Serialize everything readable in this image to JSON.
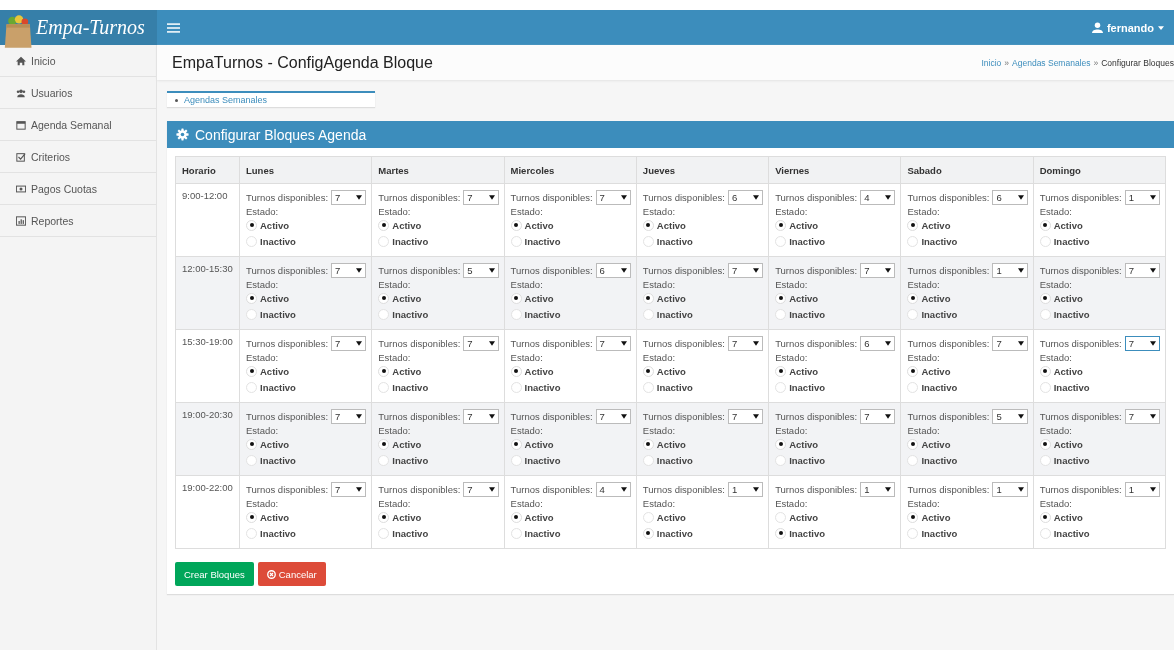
{
  "header": {
    "logo": "Empa-Turnos",
    "user": "fernando"
  },
  "sidebar": {
    "items": [
      {
        "label": "Inicio"
      },
      {
        "label": "Usuarios"
      },
      {
        "label": "Agenda Semanal"
      },
      {
        "label": "Criterios"
      },
      {
        "label": "Pagos Cuotas"
      },
      {
        "label": "Reportes"
      }
    ]
  },
  "page_title": "EmpaTurnos - ConfigAgenda Bloque",
  "breadcrumb": [
    {
      "kind": "link",
      "label": "Inicio"
    },
    {
      "kind": "sep",
      "label": "»"
    },
    {
      "kind": "link",
      "label": "Agendas Semanales"
    },
    {
      "kind": "sep",
      "label": "»"
    },
    {
      "kind": "current",
      "label": "Configurar Bloques"
    }
  ],
  "subnav": {
    "label": "Agendas Semanales"
  },
  "panel": {
    "title": "Configurar Bloques Agenda"
  },
  "table": {
    "columns": [
      "Horario",
      "Lunes",
      "Martes",
      "Miercoles",
      "Jueves",
      "Viernes",
      "Sabado",
      "Domingo"
    ],
    "rows": [
      {
        "cells": [
          {
            "kind": "time",
            "text": "9:00-12:00"
          },
          {
            "turnos_label": "Turnos disponibles:",
            "turnos": "7",
            "focused": false,
            "estado_label": "Estado:",
            "options": [
              {
                "label": "Activo",
                "selected": true
              },
              {
                "label": "Inactivo",
                "selected": false
              }
            ]
          },
          {
            "turnos_label": "Turnos disponibles:",
            "turnos": "7",
            "focused": false,
            "estado_label": "Estado:",
            "options": [
              {
                "label": "Activo",
                "selected": true
              },
              {
                "label": "Inactivo",
                "selected": false
              }
            ]
          },
          {
            "turnos_label": "Turnos disponibles:",
            "turnos": "7",
            "focused": false,
            "estado_label": "Estado:",
            "options": [
              {
                "label": "Activo",
                "selected": true
              },
              {
                "label": "Inactivo",
                "selected": false
              }
            ]
          },
          {
            "turnos_label": "Turnos disponibles:",
            "turnos": "6",
            "focused": false,
            "estado_label": "Estado:",
            "options": [
              {
                "label": "Activo",
                "selected": true
              },
              {
                "label": "Inactivo",
                "selected": false
              }
            ]
          },
          {
            "turnos_label": "Turnos disponibles:",
            "turnos": "4",
            "focused": false,
            "estado_label": "Estado:",
            "options": [
              {
                "label": "Activo",
                "selected": true
              },
              {
                "label": "Inactivo",
                "selected": false
              }
            ]
          },
          {
            "turnos_label": "Turnos disponibles:",
            "turnos": "6",
            "focused": false,
            "estado_label": "Estado:",
            "options": [
              {
                "label": "Activo",
                "selected": true
              },
              {
                "label": "Inactivo",
                "selected": false
              }
            ]
          },
          {
            "turnos_label": "Turnos disponibles:",
            "turnos": "1",
            "focused": false,
            "estado_label": "Estado:",
            "options": [
              {
                "label": "Activo",
                "selected": true
              },
              {
                "label": "Inactivo",
                "selected": false
              }
            ]
          }
        ]
      },
      {
        "cells": [
          {
            "kind": "time",
            "text": "12:00-15:30"
          },
          {
            "turnos_label": "Turnos disponibles:",
            "turnos": "7",
            "focused": false,
            "estado_label": "Estado:",
            "options": [
              {
                "label": "Activo",
                "selected": true
              },
              {
                "label": "Inactivo",
                "selected": false
              }
            ]
          },
          {
            "turnos_label": "Turnos disponibles:",
            "turnos": "5",
            "focused": false,
            "estado_label": "Estado:",
            "options": [
              {
                "label": "Activo",
                "selected": true
              },
              {
                "label": "Inactivo",
                "selected": false
              }
            ]
          },
          {
            "turnos_label": "Turnos disponibles:",
            "turnos": "6",
            "focused": false,
            "estado_label": "Estado:",
            "options": [
              {
                "label": "Activo",
                "selected": true
              },
              {
                "label": "Inactivo",
                "selected": false
              }
            ]
          },
          {
            "turnos_label": "Turnos disponibles:",
            "turnos": "7",
            "focused": false,
            "estado_label": "Estado:",
            "options": [
              {
                "label": "Activo",
                "selected": true
              },
              {
                "label": "Inactivo",
                "selected": false
              }
            ]
          },
          {
            "turnos_label": "Turnos disponibles:",
            "turnos": "7",
            "focused": false,
            "estado_label": "Estado:",
            "options": [
              {
                "label": "Activo",
                "selected": true
              },
              {
                "label": "Inactivo",
                "selected": false
              }
            ]
          },
          {
            "turnos_label": "Turnos disponibles:",
            "turnos": "1",
            "focused": false,
            "estado_label": "Estado:",
            "options": [
              {
                "label": "Activo",
                "selected": true
              },
              {
                "label": "Inactivo",
                "selected": false
              }
            ]
          },
          {
            "turnos_label": "Turnos disponibles:",
            "turnos": "7",
            "focused": false,
            "estado_label": "Estado:",
            "options": [
              {
                "label": "Activo",
                "selected": true
              },
              {
                "label": "Inactivo",
                "selected": false
              }
            ]
          }
        ]
      },
      {
        "cells": [
          {
            "kind": "time",
            "text": "15:30-19:00"
          },
          {
            "turnos_label": "Turnos disponibles:",
            "turnos": "7",
            "focused": false,
            "estado_label": "Estado:",
            "options": [
              {
                "label": "Activo",
                "selected": true
              },
              {
                "label": "Inactivo",
                "selected": false
              }
            ]
          },
          {
            "turnos_label": "Turnos disponibles:",
            "turnos": "7",
            "focused": false,
            "estado_label": "Estado:",
            "options": [
              {
                "label": "Activo",
                "selected": true
              },
              {
                "label": "Inactivo",
                "selected": false
              }
            ]
          },
          {
            "turnos_label": "Turnos disponibles:",
            "turnos": "7",
            "focused": false,
            "estado_label": "Estado:",
            "options": [
              {
                "label": "Activo",
                "selected": true
              },
              {
                "label": "Inactivo",
                "selected": false
              }
            ]
          },
          {
            "turnos_label": "Turnos disponibles:",
            "turnos": "7",
            "focused": false,
            "estado_label": "Estado:",
            "options": [
              {
                "label": "Activo",
                "selected": true
              },
              {
                "label": "Inactivo",
                "selected": false
              }
            ]
          },
          {
            "turnos_label": "Turnos disponibles:",
            "turnos": "6",
            "focused": false,
            "estado_label": "Estado:",
            "options": [
              {
                "label": "Activo",
                "selected": true
              },
              {
                "label": "Inactivo",
                "selected": false
              }
            ]
          },
          {
            "turnos_label": "Turnos disponibles:",
            "turnos": "7",
            "focused": false,
            "estado_label": "Estado:",
            "options": [
              {
                "label": "Activo",
                "selected": true
              },
              {
                "label": "Inactivo",
                "selected": false
              }
            ]
          },
          {
            "turnos_label": "Turnos disponibles:",
            "turnos": "7",
            "focused": true,
            "estado_label": "Estado:",
            "options": [
              {
                "label": "Activo",
                "selected": true
              },
              {
                "label": "Inactivo",
                "selected": false
              }
            ]
          }
        ]
      },
      {
        "cells": [
          {
            "kind": "time",
            "text": "19:00-20:30"
          },
          {
            "turnos_label": "Turnos disponibles:",
            "turnos": "7",
            "focused": false,
            "estado_label": "Estado:",
            "options": [
              {
                "label": "Activo",
                "selected": true
              },
              {
                "label": "Inactivo",
                "selected": false
              }
            ]
          },
          {
            "turnos_label": "Turnos disponibles:",
            "turnos": "7",
            "focused": false,
            "estado_label": "Estado:",
            "options": [
              {
                "label": "Activo",
                "selected": true
              },
              {
                "label": "Inactivo",
                "selected": false
              }
            ]
          },
          {
            "turnos_label": "Turnos disponibles:",
            "turnos": "7",
            "focused": false,
            "estado_label": "Estado:",
            "options": [
              {
                "label": "Activo",
                "selected": true
              },
              {
                "label": "Inactivo",
                "selected": false
              }
            ]
          },
          {
            "turnos_label": "Turnos disponibles:",
            "turnos": "7",
            "focused": false,
            "estado_label": "Estado:",
            "options": [
              {
                "label": "Activo",
                "selected": true
              },
              {
                "label": "Inactivo",
                "selected": false
              }
            ]
          },
          {
            "turnos_label": "Turnos disponibles:",
            "turnos": "7",
            "focused": false,
            "estado_label": "Estado:",
            "options": [
              {
                "label": "Activo",
                "selected": true
              },
              {
                "label": "Inactivo",
                "selected": false
              }
            ]
          },
          {
            "turnos_label": "Turnos disponibles:",
            "turnos": "5",
            "focused": false,
            "estado_label": "Estado:",
            "options": [
              {
                "label": "Activo",
                "selected": true
              },
              {
                "label": "Inactivo",
                "selected": false
              }
            ]
          },
          {
            "turnos_label": "Turnos disponibles:",
            "turnos": "7",
            "focused": false,
            "estado_label": "Estado:",
            "options": [
              {
                "label": "Activo",
                "selected": true
              },
              {
                "label": "Inactivo",
                "selected": false
              }
            ]
          }
        ]
      },
      {
        "cells": [
          {
            "kind": "time",
            "text": "19:00-22:00"
          },
          {
            "turnos_label": "Turnos disponibles:",
            "turnos": "7",
            "focused": false,
            "estado_label": "Estado:",
            "options": [
              {
                "label": "Activo",
                "selected": true
              },
              {
                "label": "Inactivo",
                "selected": false
              }
            ]
          },
          {
            "turnos_label": "Turnos disponibles:",
            "turnos": "7",
            "focused": false,
            "estado_label": "Estado:",
            "options": [
              {
                "label": "Activo",
                "selected": true
              },
              {
                "label": "Inactivo",
                "selected": false
              }
            ]
          },
          {
            "turnos_label": "Turnos disponibles:",
            "turnos": "4",
            "focused": false,
            "estado_label": "Estado:",
            "options": [
              {
                "label": "Activo",
                "selected": true
              },
              {
                "label": "Inactivo",
                "selected": false
              }
            ]
          },
          {
            "turnos_label": "Turnos disponibles:",
            "turnos": "1",
            "focused": false,
            "estado_label": "Estado:",
            "options": [
              {
                "label": "Activo",
                "selected": false
              },
              {
                "label": "Inactivo",
                "selected": true
              }
            ]
          },
          {
            "turnos_label": "Turnos disponibles:",
            "turnos": "1",
            "focused": false,
            "estado_label": "Estado:",
            "options": [
              {
                "label": "Activo",
                "selected": false
              },
              {
                "label": "Inactivo",
                "selected": true
              }
            ]
          },
          {
            "turnos_label": "Turnos disponibles:",
            "turnos": "1",
            "focused": false,
            "estado_label": "Estado:",
            "options": [
              {
                "label": "Activo",
                "selected": true
              },
              {
                "label": "Inactivo",
                "selected": false
              }
            ]
          },
          {
            "turnos_label": "Turnos disponibles:",
            "turnos": "1",
            "focused": false,
            "estado_label": "Estado:",
            "options": [
              {
                "label": "Activo",
                "selected": true
              },
              {
                "label": "Inactivo",
                "selected": false
              }
            ]
          }
        ]
      }
    ]
  },
  "buttons": [
    {
      "kind": "primary",
      "label": "Crear Bloques"
    },
    {
      "kind": "danger",
      "label": "Cancelar"
    }
  ]
}
